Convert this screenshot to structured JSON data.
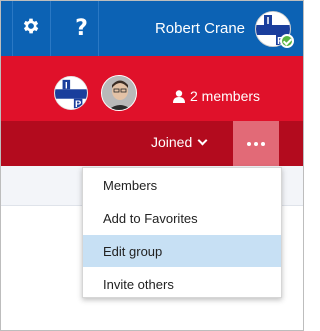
{
  "topbar": {
    "settings_icon": "gear-icon",
    "help_label": "?",
    "user_name": "Robert Crane",
    "user_status": "available",
    "background": "#0c62b4"
  },
  "group": {
    "avatar_letters": [
      "I",
      "P"
    ],
    "members_count_label": "2 members",
    "members_icon": "person-icon",
    "background": "#e0112a"
  },
  "actions": {
    "joined_label": "Joined",
    "more_label": "...",
    "background": "#b30b1e",
    "more_background": "#e26a77"
  },
  "menu": {
    "items": [
      {
        "label": "Members",
        "highlighted": false
      },
      {
        "label": "Add to Favorites",
        "highlighted": false
      },
      {
        "label": "Edit group",
        "highlighted": true
      },
      {
        "label": "Invite others",
        "highlighted": false
      }
    ],
    "highlight_color": "#c7e0f4"
  }
}
